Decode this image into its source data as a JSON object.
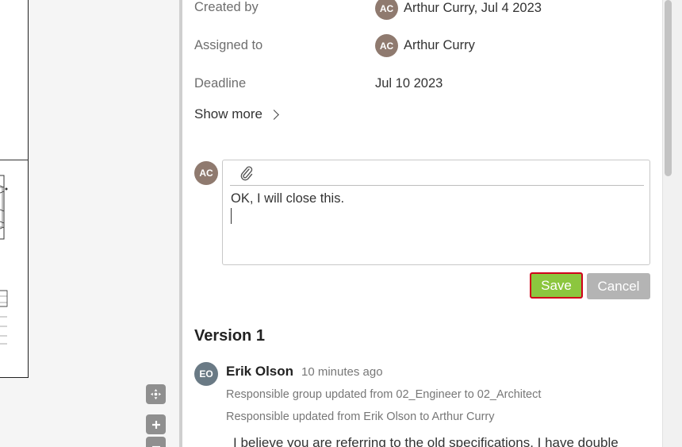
{
  "details": {
    "created_by_label": "Created by",
    "created_by_initials": "AC",
    "created_by_value": "Arthur Curry, Jul 4 2023",
    "assigned_to_label": "Assigned to",
    "assigned_to_initials": "AC",
    "assigned_to_value": "Arthur Curry",
    "deadline_label": "Deadline",
    "deadline_value": "Jul 10 2023",
    "show_more": "Show more"
  },
  "comment_editor": {
    "avatar_initials": "AC",
    "text": "OK, I will close this.",
    "attach_icon": "paperclip-icon"
  },
  "actions": {
    "save": "Save",
    "cancel": "Cancel"
  },
  "history": {
    "version_title": "Version 1",
    "author_initials": "EO",
    "author": "Erik Olson",
    "time": "10 minutes ago",
    "change_1": "Responsible group updated from 02_Engineer to 02_Architect",
    "change_2": "Responsible updated from Erik Olson to Arthur Curry",
    "comment": "I believe you are referring to the old specifications. I have double"
  },
  "viewer_tools": {
    "pan": "move-icon",
    "zoom_in": "plus-icon",
    "zoom_out": "minus-icon"
  },
  "colors": {
    "save_green": "#8cc63e",
    "cancel_gray": "#b4b4b4",
    "avatar_ac": "#8f7a6f",
    "avatar_eo": "#6a7a85",
    "highlight_red": "#d0021b"
  }
}
